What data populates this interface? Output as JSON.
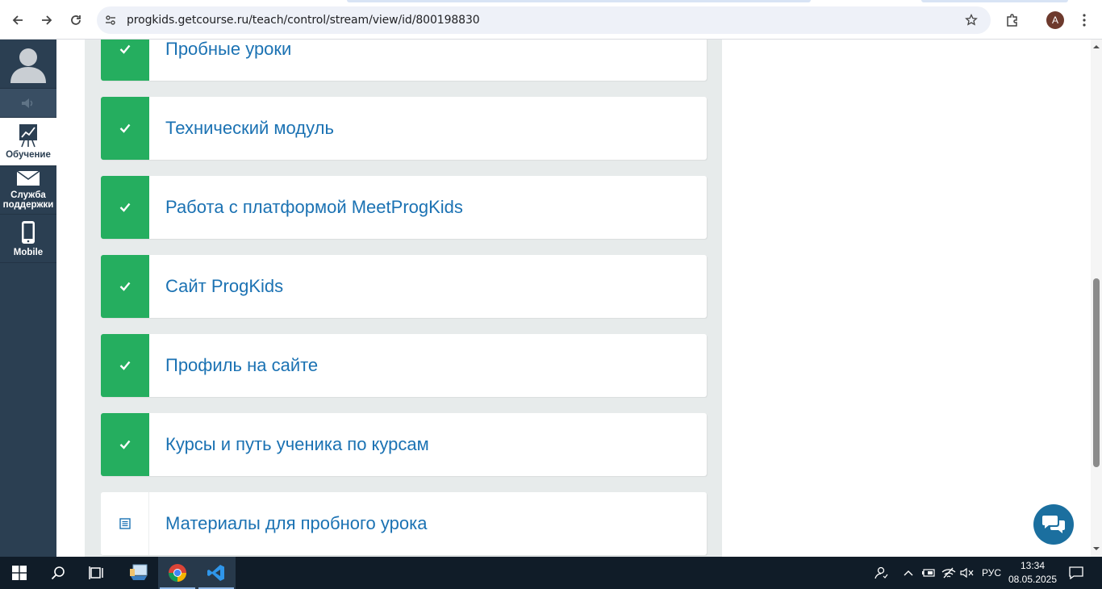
{
  "browser": {
    "url": "progkids.getcourse.ru/teach/control/stream/view/id/800198830",
    "profile_initial": "A"
  },
  "sidebar": {
    "items": [
      {
        "label": "Обучение",
        "icon": "chart-icon"
      },
      {
        "label": "Служба поддержки",
        "icon": "envelope-icon"
      },
      {
        "label": "Mobile",
        "icon": "phone-icon"
      }
    ]
  },
  "lessons": [
    {
      "title": "Пробные уроки",
      "status": "completed"
    },
    {
      "title": "Технический модуль",
      "status": "completed"
    },
    {
      "title": "Работа с платформой MeetProgKids",
      "status": "completed"
    },
    {
      "title": "Сайт ProgKids",
      "status": "completed"
    },
    {
      "title": "Профиль на сайте",
      "status": "completed"
    },
    {
      "title": "Курсы и путь ученика по курсам",
      "status": "completed"
    },
    {
      "title": "Материалы для пробного урока",
      "status": "document"
    }
  ],
  "colors": {
    "completed": "#25ae5f",
    "title": "#1b72b3",
    "sidebar": "#2b3f52"
  },
  "taskbar": {
    "language": "РУС",
    "time": "13:34",
    "date": "08.05.2025"
  }
}
